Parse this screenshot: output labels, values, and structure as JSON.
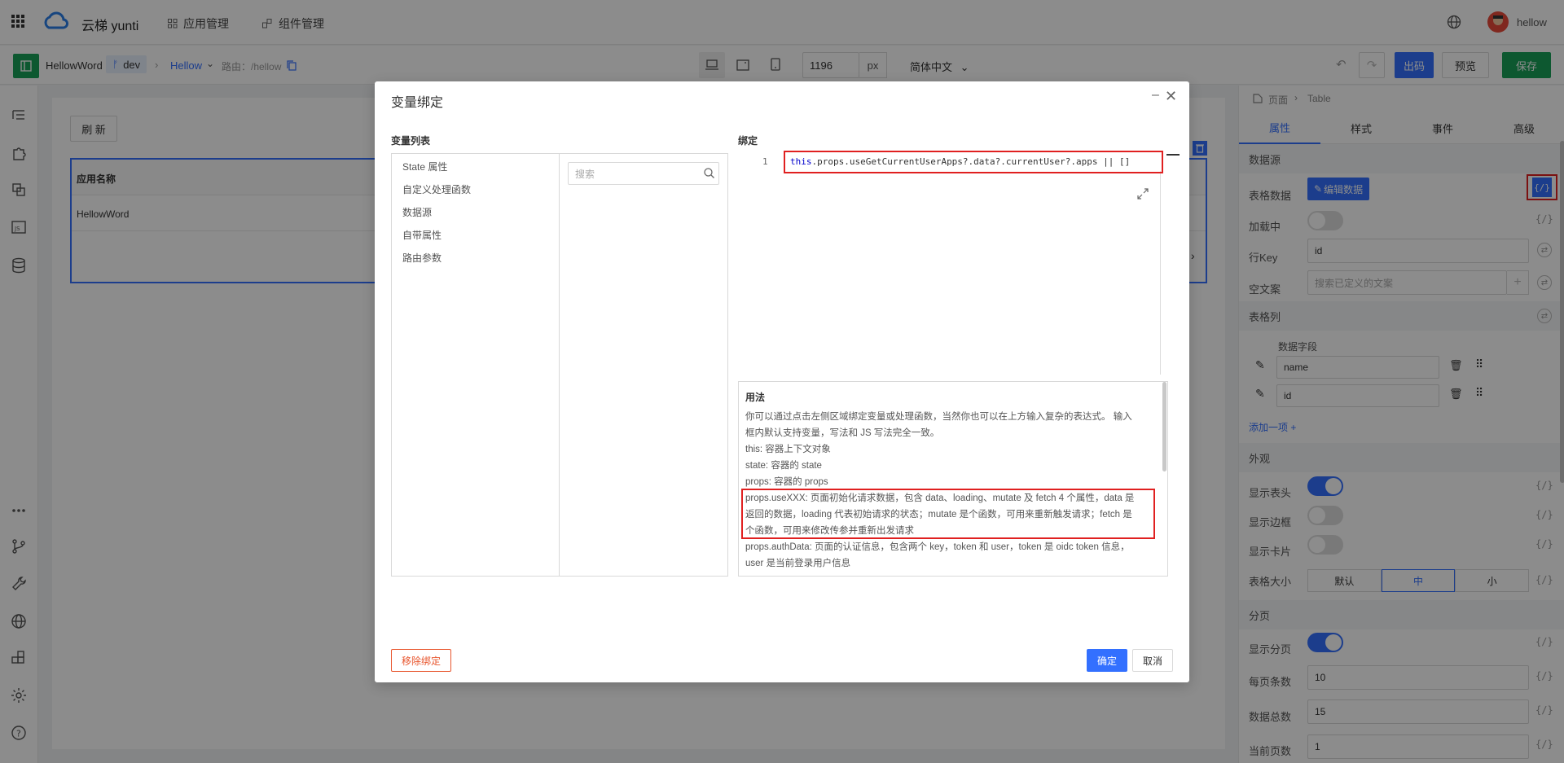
{
  "topbar": {
    "brand": "云梯 yunti",
    "nav": [
      "应用管理",
      "组件管理"
    ],
    "user": "hellow"
  },
  "toolbar": {
    "app_name": "HellowWord",
    "branch": "dev",
    "page_name": "Hellow",
    "route_label": "路由：/hellow",
    "width_value": "1196",
    "width_unit": "px",
    "language": "简体中文",
    "code_button": "出码",
    "preview_button": "预览",
    "save_button": "保存"
  },
  "canvas": {
    "refresh_button": "刷 新",
    "table_header": "应用名称",
    "table_row": "HellowWord"
  },
  "right_panel": {
    "breadcrumb_page": "页面",
    "breadcrumb_component": "Table",
    "tabs": [
      "属性",
      "样式",
      "事件",
      "高级"
    ],
    "datasource_section": "数据源",
    "table_data_label": "表格数据",
    "edit_data_button": "编辑数据",
    "loading_label": "加载中",
    "rowkey_label": "行Key",
    "rowkey_value": "id",
    "empty_label": "空文案",
    "empty_placeholder": "搜索已定义的文案",
    "columns_section": "表格列",
    "data_field_label": "数据字段",
    "columns": [
      "name",
      "id"
    ],
    "add_item": "添加一项 +",
    "appearance_section": "外观",
    "show_header_label": "显示表头",
    "show_border_label": "显示边框",
    "show_card_label": "显示卡片",
    "size_label": "表格大小",
    "size_options": [
      "默认",
      "中",
      "小"
    ],
    "size_selected": "中",
    "pagination_section": "分页",
    "show_pagination_label": "显示分页",
    "page_size_label": "每页条数",
    "page_size_value": "10",
    "total_label": "数据总数",
    "total_value": "15",
    "current_label": "当前页数",
    "current_value": "1",
    "fx_label": "{/}"
  },
  "modal": {
    "title": "变量绑定",
    "var_list_title": "变量列表",
    "var_items": [
      "State 属性",
      "自定义处理函数",
      "数据源",
      "自带属性",
      "路由参数"
    ],
    "search_placeholder": "搜索",
    "binding_title": "绑定",
    "line_number": "1",
    "code_this": "this",
    "code_rest": ".props.useGetCurrentUserApps?.data?.currentUser?.apps || []",
    "usage_title": "用法",
    "usage_lines": [
      "你可以通过点击左侧区域绑定变量或处理函数，当然你也可以在上方输入复杂的表达式。 输入",
      "框内默认支持变量，写法和 JS 写法完全一致。",
      "this: 容器上下文对象",
      "state: 容器的 state",
      "props: 容器的 props",
      "props.useXXX: 页面初始化请求数据，包含 data、loading、mutate 及 fetch 4 个属性，data 是",
      "返回的数据，loading 代表初始请求的状态；mutate 是个函数，可用来重新触发请求；fetch 是",
      "个函数，可用来修改传参并重新出发请求",
      "props.authData: 页面的认证信息，包含两个 key，token 和 user，token 是 oidc token 信息，",
      "user 是当前登录用户信息"
    ],
    "remove_button": "移除绑定",
    "confirm_button": "确定",
    "cancel_button": "取消"
  },
  "colors": {
    "accent": "#3370ff",
    "save": "#18a058",
    "highlight": "#e02020"
  }
}
